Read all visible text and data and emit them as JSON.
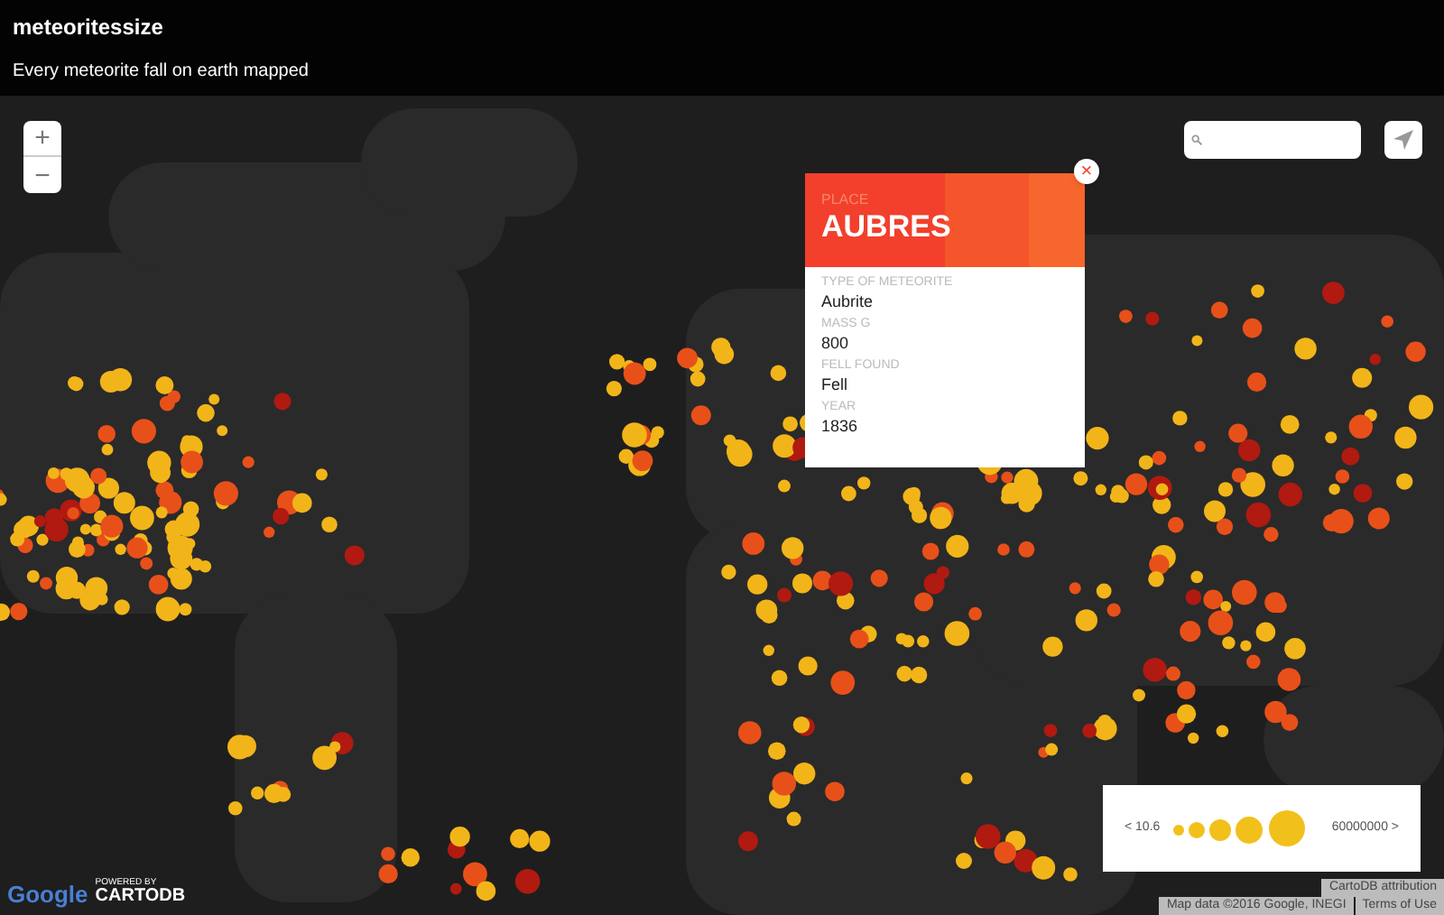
{
  "header": {
    "title": "meteoritessize",
    "subtitle": "Every meteorite fall on earth mapped"
  },
  "zoom": {
    "in": "+",
    "out": "−"
  },
  "popup": {
    "close": "×",
    "heading_label": "PLACE",
    "heading_value": "AUBRES",
    "fields": [
      {
        "label": "TYPE OF METEORITE",
        "value": "Aubrite"
      },
      {
        "label": "MASS G",
        "value": "800"
      },
      {
        "label": "FELL FOUND",
        "value": "Fell"
      },
      {
        "label": "YEAR",
        "value": "1836"
      }
    ]
  },
  "legend": {
    "min": "< 10.6",
    "max": "60000000 >"
  },
  "branding": {
    "google": "Google",
    "powered_by": "POWERED BY",
    "cartodb": "CARTODB"
  },
  "attribution": {
    "cartodb": "CartoDB attribution",
    "map_data": "Map data ©2016 Google, INEGI",
    "terms": "Terms of Use"
  }
}
